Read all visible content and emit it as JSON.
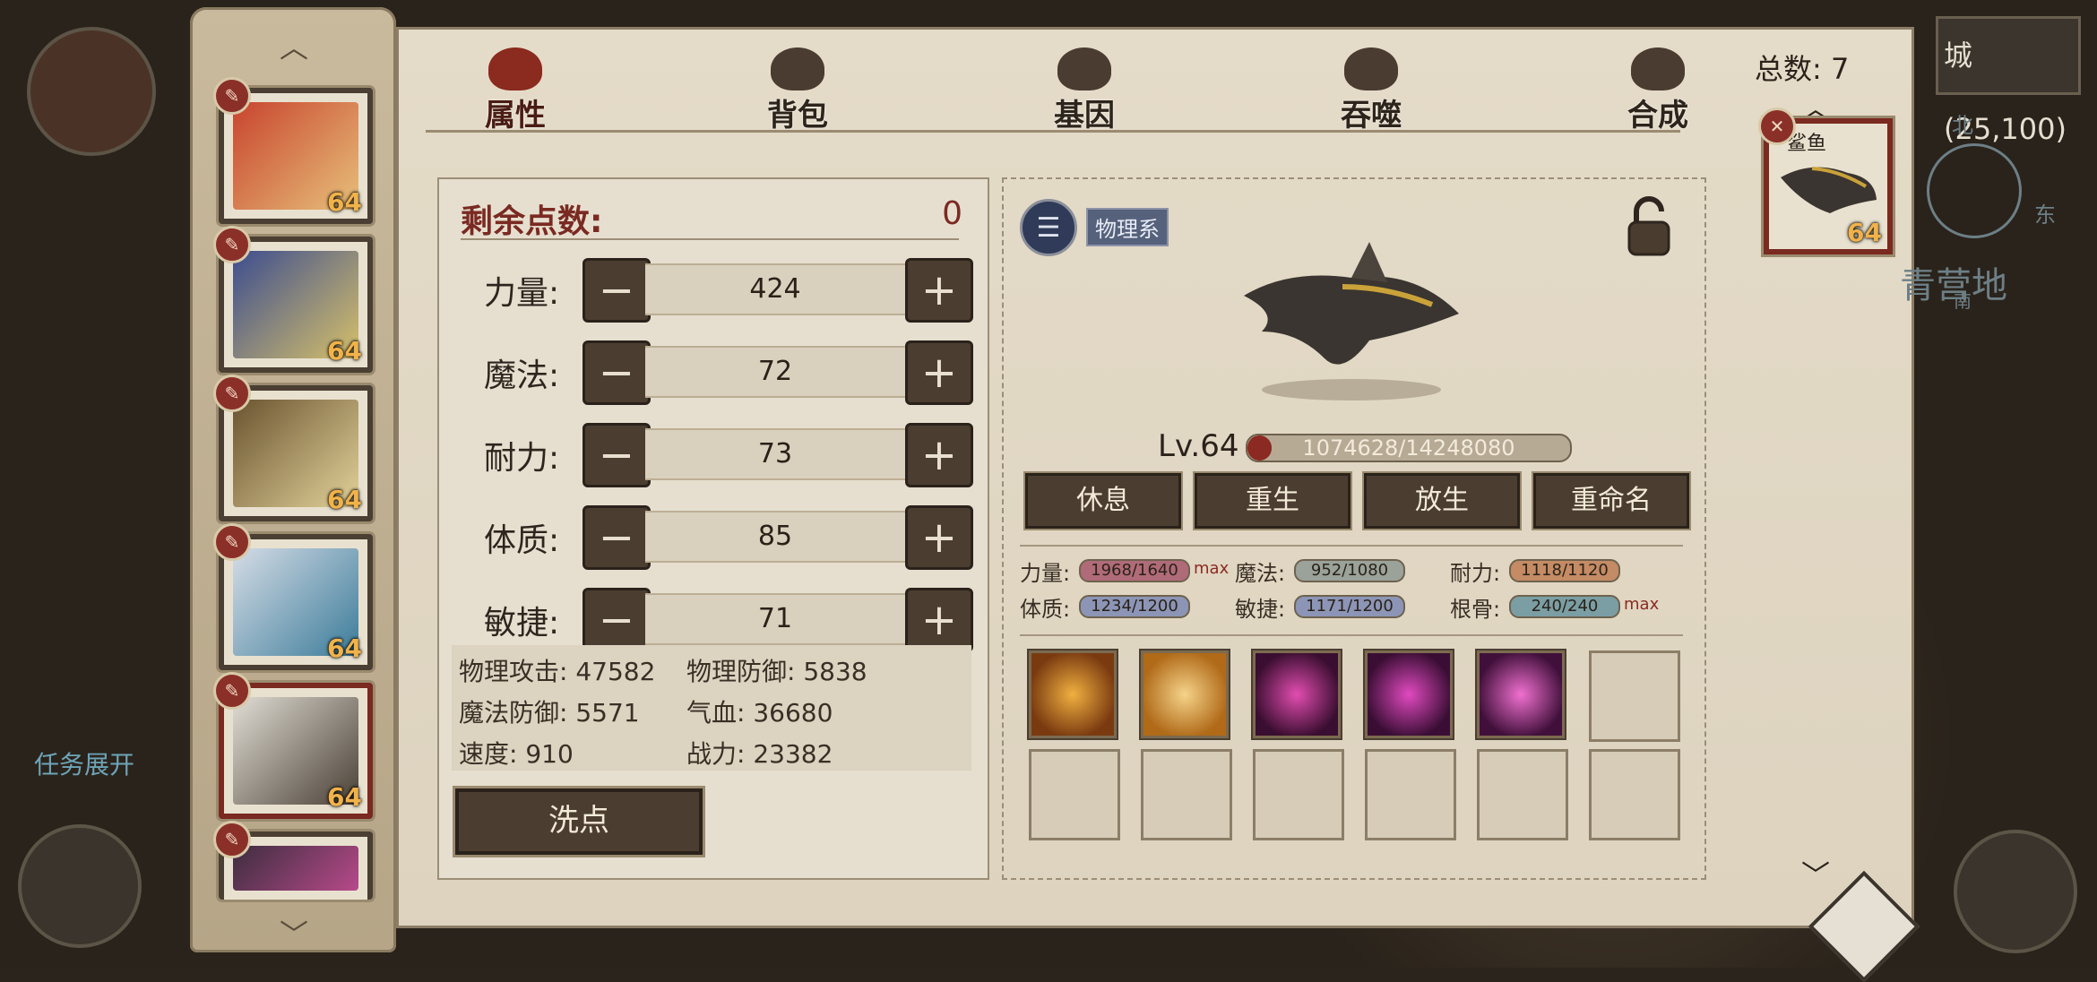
{
  "tabs": [
    {
      "label": "属性",
      "icon": "fire-icon",
      "active": true
    },
    {
      "label": "背包",
      "icon": "bag-icon",
      "active": false
    },
    {
      "label": "基因",
      "icon": "gene-icon",
      "active": false
    },
    {
      "label": "吞噬",
      "icon": "devour-icon",
      "active": false
    },
    {
      "label": "合成",
      "icon": "merge-icon",
      "active": false
    }
  ],
  "pet_list": [
    {
      "level": "64",
      "colors": [
        "#c8442e",
        "#e7c07a"
      ]
    },
    {
      "level": "64",
      "colors": [
        "#3c4d8f",
        "#d6c06a"
      ]
    },
    {
      "level": "64",
      "colors": [
        "#6a5430",
        "#e3d29a"
      ]
    },
    {
      "level": "64",
      "colors": [
        "#d5dce6",
        "#3c7c9a"
      ]
    },
    {
      "level": "64",
      "colors": [
        "#e0ddd4",
        "#4a4036"
      ]
    },
    {
      "level": "",
      "colors": [
        "#3d2d3f",
        "#b74a8a"
      ]
    }
  ],
  "attributes": {
    "remaining_label": "剩余点数:",
    "remaining_value": "0",
    "rows": [
      {
        "name": "力量:",
        "value": "424"
      },
      {
        "name": "魔法:",
        "value": "72"
      },
      {
        "name": "耐力:",
        "value": "73"
      },
      {
        "name": "体质:",
        "value": "85"
      },
      {
        "name": "敏捷:",
        "value": "71"
      }
    ],
    "stats": {
      "phys_atk": "物理攻击: 47582",
      "phys_def": "物理防御: 5838",
      "mag_def": "魔法防御: 5571",
      "hp": "气血: 36680",
      "speed": "速度: 910",
      "power": "战力: 23382"
    },
    "reset_label": "洗点"
  },
  "detail": {
    "type_tag": "物理系",
    "level": "Lv.64",
    "xp_text": "1074628/14248080",
    "xp_fraction": 0.075,
    "actions": [
      "休息",
      "重生",
      "放生",
      "重命名"
    ],
    "quals": [
      {
        "label": "力量:",
        "value": "1968/1640",
        "color": "#b06b79",
        "max": "max"
      },
      {
        "label": "魔法:",
        "value": "952/1080",
        "color": "#9aa29a",
        "max": ""
      },
      {
        "label": "耐力:",
        "value": "1118/1120",
        "color": "#c48b64",
        "max": ""
      },
      {
        "label": "体质:",
        "value": "1234/1200",
        "color": "#8c95b6",
        "max": ""
      },
      {
        "label": "敏捷:",
        "value": "1171/1200",
        "color": "#8c95b6",
        "max": ""
      },
      {
        "label": "根骨:",
        "value": "240/240",
        "color": "#7a9ea4",
        "max": "max"
      }
    ],
    "skills": [
      {
        "color1": "#f0b040",
        "color2": "#7a3a10"
      },
      {
        "color1": "#f5d38a",
        "color2": "#b06a18"
      },
      {
        "color1": "#e14db0",
        "color2": "#3a0e30"
      },
      {
        "color1": "#e04ac0",
        "color2": "#3a0e34"
      },
      {
        "color1": "#f070d0",
        "color2": "#40103a"
      }
    ]
  },
  "right": {
    "total": "总数: 7",
    "selected_name": "鲨鱼",
    "selected_level": "64",
    "city_text": "城(25,100)",
    "camp_text": "青营地",
    "compass_n": "北",
    "compass_e": "东",
    "compass_s": "南"
  },
  "quest_toggle": "任务展开"
}
